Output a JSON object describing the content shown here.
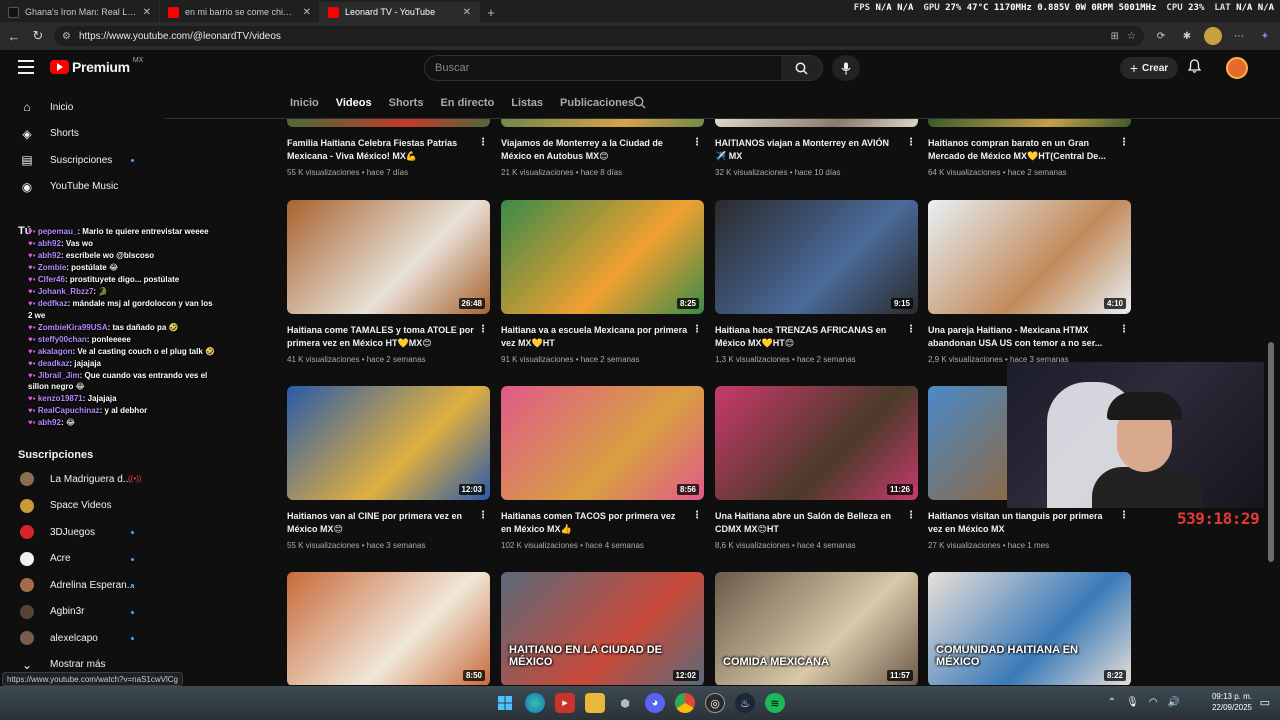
{
  "browser": {
    "tabs": [
      {
        "title": "Ghana's Iron Man: Real Life Wak...",
        "favicon_color": "#111111",
        "active": false
      },
      {
        "title": "en mi barrio se come chingon - Y...",
        "favicon_color": "#ff0000",
        "active": false
      },
      {
        "title": "Leonard TV - YouTube",
        "favicon_color": "#ff0000",
        "active": true
      }
    ],
    "url": "https://www.youtube.com/@leonardTV/videos",
    "status_url": "https://www.youtube.com/watch?v=naS1cwVlCg"
  },
  "osd": {
    "fps_label": "FPS",
    "fps_value": "N/A  N/A",
    "gpu_label": "GPU",
    "gpu_value": "27% 47°C 1170MHz 0.885V 0W 0RPM 5001MHz",
    "cpu_label": "CPU",
    "cpu_value": "23%",
    "lat_label": "LAT",
    "lat_value": "N/A  N/A"
  },
  "masthead": {
    "logo": "Premium",
    "logo_country": "MX",
    "search_placeholder": "Buscar",
    "create_label": "Crear"
  },
  "sidebar": {
    "main": [
      {
        "label": "Inicio",
        "icon": "home-icon",
        "glyph": "⌂"
      },
      {
        "label": "Shorts",
        "icon": "shorts-icon",
        "glyph": "◈"
      },
      {
        "label": "Suscripciones",
        "icon": "subscriptions-icon",
        "glyph": "▤",
        "dot": true
      },
      {
        "label": "YouTube Music",
        "icon": "music-icon",
        "glyph": "◉"
      }
    ],
    "you_section": "Tú",
    "subs_section": "Suscripciones",
    "subscriptions": [
      {
        "name": "La Madriguera d...",
        "color": "#8a6d4f",
        "live": true
      },
      {
        "name": "Space Videos",
        "color": "#c89a3a",
        "live": false
      },
      {
        "name": "3DJuegos",
        "color": "#d8232a",
        "live": false,
        "dot": true
      },
      {
        "name": "Acre",
        "color": "#f1f1f1",
        "live": false,
        "dot": true
      },
      {
        "name": "Adrelina Esperan...",
        "color": "#a46b4a",
        "live": false,
        "dot": true
      },
      {
        "name": "Agbin3r",
        "color": "#5a4233",
        "live": false,
        "dot": true
      },
      {
        "name": "alexelcapo",
        "color": "#7a5c4f",
        "live": false,
        "dot": true
      }
    ],
    "show_more": "Mostrar más"
  },
  "chat": [
    {
      "user": "pepemau_",
      "msg": "Mario te quiere entrevistar weeee"
    },
    {
      "user": "abh92",
      "msg": "Vas wo"
    },
    {
      "user": "abh92",
      "msg": "escribele wo @blscoso"
    },
    {
      "user": "Zombie",
      "msg": "postúlate 😂"
    },
    {
      "user": "Clfer46",
      "msg": "prostituyete digo... postúlate"
    },
    {
      "user": "Johank_Rbzz7",
      "msg": "🐊"
    },
    {
      "user": "dedfkaz",
      "msg": "mándale msj al gordolocon y van los 2 we"
    },
    {
      "user": "ZombieKira99USA",
      "msg": "tas dañado pa 🤣"
    },
    {
      "user": "steffy00chan",
      "msg": "ponleeeee"
    },
    {
      "user": "akalagon",
      "msg": "Ve al casting couch o el plug talk 🤣"
    },
    {
      "user": "deadkaz",
      "msg": "jajajaja"
    },
    {
      "user": "Jibrail_Jim",
      "msg": "Que cuando vas entrando ves el sillon negro 😂"
    },
    {
      "user": "kenzo19871",
      "msg": "Jajajaja"
    },
    {
      "user": "RealCapuchinaz",
      "msg": "y al debhor"
    },
    {
      "user": "abh92",
      "msg": "😂"
    }
  ],
  "content_tabs": [
    "Inicio",
    "Videos",
    "Shorts",
    "En directo",
    "Listas",
    "Publicaciones"
  ],
  "active_tab": "Videos",
  "videos": [
    [
      {
        "title": "Familia Haitiana Celebra Fiestas Patrias Mexicana - Viva México! MX💪",
        "views": "55 K visualizaciones",
        "age": "hace 7 días",
        "duration": "",
        "palette": [
          "#4a6b3a",
          "#c23a2a"
        ]
      },
      {
        "title": "Viajamos de Monterrey a la Ciudad de México en Autobus MX😊",
        "views": "21 K visualizaciones",
        "age": "hace 8 días",
        "duration": "",
        "palette": [
          "#6b8a4a",
          "#d9a14a"
        ]
      },
      {
        "title": "HAITIANOS viajan a Monterrey en AVIÓN ✈️ MX",
        "views": "32 K visualizaciones",
        "age": "hace 10 días",
        "duration": "",
        "palette": [
          "#e0d8c8",
          "#8a7a6a"
        ]
      },
      {
        "title": "Haitianos compran barato en un Gran Mercado de México MX💛HT(Central De...",
        "views": "64 K visualizaciones",
        "age": "hace 2 semanas",
        "duration": "",
        "palette": [
          "#3a5a2a",
          "#c4a04a"
        ]
      }
    ],
    [
      {
        "title": "Haitiana come TAMALES y toma ATOLE por primera vez en México HT💛MX😊",
        "views": "41 K visualizaciones",
        "age": "hace 2 semanas",
        "duration": "26:48",
        "palette": [
          "#a8632e",
          "#e8e2d8"
        ]
      },
      {
        "title": "Haitiana va a escuela Mexicana por primera vez MX💛HT",
        "views": "91 K visualizaciones",
        "age": "hace 2 semanas",
        "duration": "8:25",
        "palette": [
          "#3a8a4a",
          "#f0a030"
        ]
      },
      {
        "title": "Haitiana hace TRENZAS AFRICANAS en México MX💛HT😊",
        "views": "1,3 K visualizaciones",
        "age": "hace 2 semanas",
        "duration": "9:15",
        "palette": [
          "#2a2a2a",
          "#4a6a9a"
        ]
      },
      {
        "title": "Una pareja Haitiano - Mexicana HTMX abandonan USA US con temor a no ser...",
        "views": "2,9 K visualizaciones",
        "age": "hace 3 semanas",
        "duration": "4:10",
        "palette": [
          "#e8f0f5",
          "#c28a5a"
        ]
      }
    ],
    [
      {
        "title": "Haitianos van al CINE por primera vez en México MX😊",
        "views": "55 K visualizaciones",
        "age": "hace 3 semanas",
        "duration": "12:03",
        "palette": [
          "#2a5aa8",
          "#e0b040"
        ]
      },
      {
        "title": "Haitianas comen TACOS por primera vez en México MX👍",
        "views": "102 K visualizaciones",
        "age": "hace 4 semanas",
        "duration": "8:56",
        "palette": [
          "#e05a8a",
          "#d8a040"
        ]
      },
      {
        "title": "Una Haitiana abre un Salón de Belleza en CDMX MX😊HT",
        "views": "8,6 K visualizaciones",
        "age": "hace 4 semanas",
        "duration": "11:26",
        "palette": [
          "#c83a6a",
          "#4a3a2a"
        ]
      },
      {
        "title": "Haitianos visitan un tianguis por primera vez en México MX",
        "views": "27 K visualizaciones",
        "age": "hace 1 mes",
        "duration": "",
        "palette": [
          "#4a8ac8",
          "#8a6a4a"
        ]
      }
    ],
    [
      {
        "title": "",
        "views": "",
        "age": "",
        "duration": "8:50",
        "palette": [
          "#c86a3a",
          "#f0e8d8"
        ]
      },
      {
        "title": "",
        "views": "",
        "age": "",
        "duration": "12:02",
        "palette": [
          "#5a6a7a",
          "#c84a3a"
        ]
      },
      {
        "title": "",
        "views": "",
        "age": "",
        "duration": "11:57",
        "palette": [
          "#6a5a4a",
          "#d8c8a8"
        ]
      },
      {
        "title": "",
        "views": "",
        "age": "",
        "duration": "8:22",
        "palette": [
          "#e8e0d8",
          "#3a7ab8"
        ]
      }
    ]
  ],
  "thumb_text": {
    "r3c1": "HAITIANO EN LA CIUDAD DE MÉXICO",
    "r3c2": "COMIDA MEXICANA",
    "r3c3": "COMUNIDAD HAITIANA EN MÉXICO"
  },
  "stream": {
    "timer": "539:18:29"
  },
  "taskbar": {
    "time": "09:13 p. m.",
    "date": "22/09/2025"
  },
  "colors": {
    "accent_red": "#ff0000",
    "link_blue": "#3ea6ff",
    "background": "#0f0f0f"
  }
}
